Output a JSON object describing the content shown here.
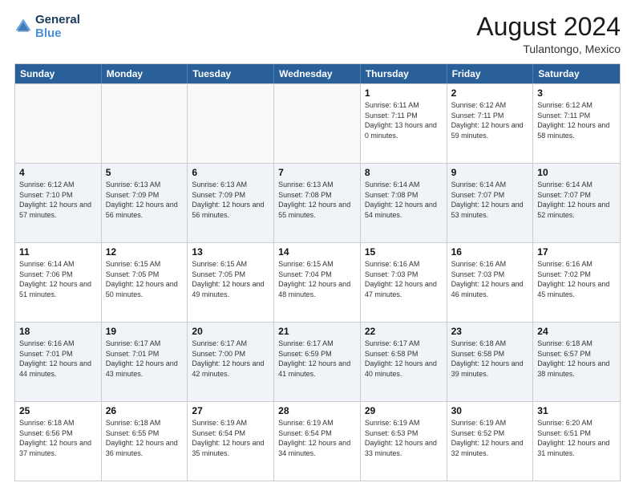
{
  "logo": {
    "line1": "General",
    "line2": "Blue"
  },
  "title": "August 2024",
  "subtitle": "Tulantongo, Mexico",
  "header_days": [
    "Sunday",
    "Monday",
    "Tuesday",
    "Wednesday",
    "Thursday",
    "Friday",
    "Saturday"
  ],
  "weeks": [
    [
      {
        "day": "",
        "info": ""
      },
      {
        "day": "",
        "info": ""
      },
      {
        "day": "",
        "info": ""
      },
      {
        "day": "",
        "info": ""
      },
      {
        "day": "1",
        "info": "Sunrise: 6:11 AM\nSunset: 7:11 PM\nDaylight: 13 hours\nand 0 minutes."
      },
      {
        "day": "2",
        "info": "Sunrise: 6:12 AM\nSunset: 7:11 PM\nDaylight: 12 hours\nand 59 minutes."
      },
      {
        "day": "3",
        "info": "Sunrise: 6:12 AM\nSunset: 7:11 PM\nDaylight: 12 hours\nand 58 minutes."
      }
    ],
    [
      {
        "day": "4",
        "info": "Sunrise: 6:12 AM\nSunset: 7:10 PM\nDaylight: 12 hours\nand 57 minutes."
      },
      {
        "day": "5",
        "info": "Sunrise: 6:13 AM\nSunset: 7:09 PM\nDaylight: 12 hours\nand 56 minutes."
      },
      {
        "day": "6",
        "info": "Sunrise: 6:13 AM\nSunset: 7:09 PM\nDaylight: 12 hours\nand 56 minutes."
      },
      {
        "day": "7",
        "info": "Sunrise: 6:13 AM\nSunset: 7:08 PM\nDaylight: 12 hours\nand 55 minutes."
      },
      {
        "day": "8",
        "info": "Sunrise: 6:14 AM\nSunset: 7:08 PM\nDaylight: 12 hours\nand 54 minutes."
      },
      {
        "day": "9",
        "info": "Sunrise: 6:14 AM\nSunset: 7:07 PM\nDaylight: 12 hours\nand 53 minutes."
      },
      {
        "day": "10",
        "info": "Sunrise: 6:14 AM\nSunset: 7:07 PM\nDaylight: 12 hours\nand 52 minutes."
      }
    ],
    [
      {
        "day": "11",
        "info": "Sunrise: 6:14 AM\nSunset: 7:06 PM\nDaylight: 12 hours\nand 51 minutes."
      },
      {
        "day": "12",
        "info": "Sunrise: 6:15 AM\nSunset: 7:05 PM\nDaylight: 12 hours\nand 50 minutes."
      },
      {
        "day": "13",
        "info": "Sunrise: 6:15 AM\nSunset: 7:05 PM\nDaylight: 12 hours\nand 49 minutes."
      },
      {
        "day": "14",
        "info": "Sunrise: 6:15 AM\nSunset: 7:04 PM\nDaylight: 12 hours\nand 48 minutes."
      },
      {
        "day": "15",
        "info": "Sunrise: 6:16 AM\nSunset: 7:03 PM\nDaylight: 12 hours\nand 47 minutes."
      },
      {
        "day": "16",
        "info": "Sunrise: 6:16 AM\nSunset: 7:03 PM\nDaylight: 12 hours\nand 46 minutes."
      },
      {
        "day": "17",
        "info": "Sunrise: 6:16 AM\nSunset: 7:02 PM\nDaylight: 12 hours\nand 45 minutes."
      }
    ],
    [
      {
        "day": "18",
        "info": "Sunrise: 6:16 AM\nSunset: 7:01 PM\nDaylight: 12 hours\nand 44 minutes."
      },
      {
        "day": "19",
        "info": "Sunrise: 6:17 AM\nSunset: 7:01 PM\nDaylight: 12 hours\nand 43 minutes."
      },
      {
        "day": "20",
        "info": "Sunrise: 6:17 AM\nSunset: 7:00 PM\nDaylight: 12 hours\nand 42 minutes."
      },
      {
        "day": "21",
        "info": "Sunrise: 6:17 AM\nSunset: 6:59 PM\nDaylight: 12 hours\nand 41 minutes."
      },
      {
        "day": "22",
        "info": "Sunrise: 6:17 AM\nSunset: 6:58 PM\nDaylight: 12 hours\nand 40 minutes."
      },
      {
        "day": "23",
        "info": "Sunrise: 6:18 AM\nSunset: 6:58 PM\nDaylight: 12 hours\nand 39 minutes."
      },
      {
        "day": "24",
        "info": "Sunrise: 6:18 AM\nSunset: 6:57 PM\nDaylight: 12 hours\nand 38 minutes."
      }
    ],
    [
      {
        "day": "25",
        "info": "Sunrise: 6:18 AM\nSunset: 6:56 PM\nDaylight: 12 hours\nand 37 minutes."
      },
      {
        "day": "26",
        "info": "Sunrise: 6:18 AM\nSunset: 6:55 PM\nDaylight: 12 hours\nand 36 minutes."
      },
      {
        "day": "27",
        "info": "Sunrise: 6:19 AM\nSunset: 6:54 PM\nDaylight: 12 hours\nand 35 minutes."
      },
      {
        "day": "28",
        "info": "Sunrise: 6:19 AM\nSunset: 6:54 PM\nDaylight: 12 hours\nand 34 minutes."
      },
      {
        "day": "29",
        "info": "Sunrise: 6:19 AM\nSunset: 6:53 PM\nDaylight: 12 hours\nand 33 minutes."
      },
      {
        "day": "30",
        "info": "Sunrise: 6:19 AM\nSunset: 6:52 PM\nDaylight: 12 hours\nand 32 minutes."
      },
      {
        "day": "31",
        "info": "Sunrise: 6:20 AM\nSunset: 6:51 PM\nDaylight: 12 hours\nand 31 minutes."
      }
    ]
  ]
}
